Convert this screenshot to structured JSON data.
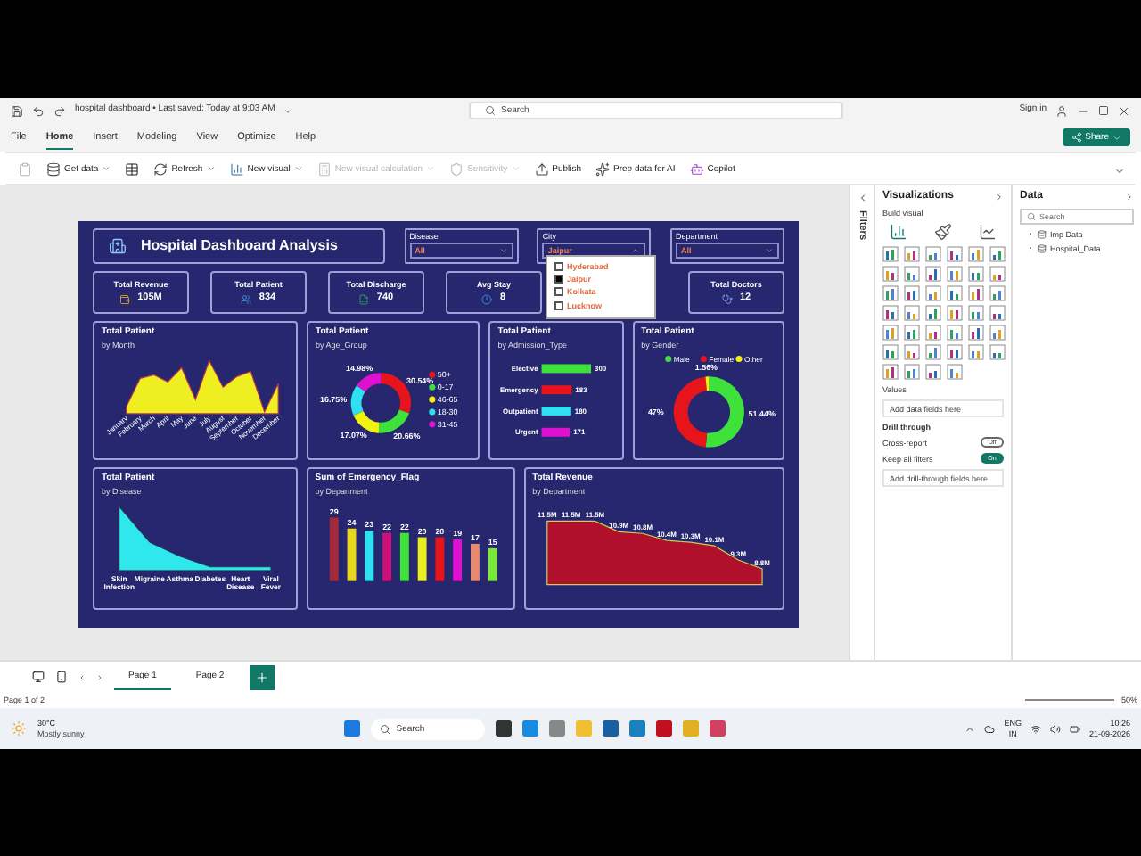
{
  "titlebar": {
    "file_title": "hospital dashboard • Last saved: Today at 9:03 AM",
    "search": "Search",
    "sign_in": "Sign in"
  },
  "menu": [
    {
      "label": "File",
      "selected": false
    },
    {
      "label": "Home",
      "selected": true
    },
    {
      "label": "Insert",
      "selected": false
    },
    {
      "label": "Modeling",
      "selected": false
    },
    {
      "label": "View",
      "selected": false
    },
    {
      "label": "Optimize",
      "selected": false
    },
    {
      "label": "Help",
      "selected": false
    }
  ],
  "share": "Share",
  "ribbon": [
    {
      "label": "Get data",
      "disabled": false
    },
    {
      "label": "Refresh",
      "disabled": false
    },
    {
      "label": "New visual",
      "disabled": false
    },
    {
      "label": "New visual calculation",
      "disabled": true
    },
    {
      "label": "Sensitivity",
      "disabled": true
    },
    {
      "label": "Publish",
      "disabled": false
    },
    {
      "label": "Prep data for AI",
      "disabled": false
    },
    {
      "label": "Copilot",
      "disabled": false
    }
  ],
  "dashboard": {
    "title": "Hospital Dashboard Analysis",
    "slicers": [
      {
        "label": "Disease",
        "value": "All",
        "open": false
      },
      {
        "label": "City",
        "value": "Jaipur",
        "open": true
      },
      {
        "label": "Department",
        "value": "All",
        "open": false
      }
    ],
    "city_options": [
      {
        "label": "Hyderabad",
        "checked": false
      },
      {
        "label": "Jaipur",
        "checked": true
      },
      {
        "label": "Kolkata",
        "checked": false
      },
      {
        "label": "Lucknow",
        "checked": false
      }
    ],
    "kpis": [
      {
        "label": "Total Revenue",
        "value": "105M"
      },
      {
        "label": "Total Patient",
        "value": "834"
      },
      {
        "label": "Total Discharge",
        "value": "740"
      },
      {
        "label": "Avg Stay",
        "value": "8"
      },
      {
        "label": "Total Doctors",
        "value": "12"
      }
    ],
    "charts_top": [
      {
        "kind": "month_area",
        "title": "Total Patient",
        "subtitle": "by Month",
        "x_labels": [
          "January",
          "February",
          "March",
          "April",
          "May",
          "June",
          "July",
          "August",
          "September",
          "October",
          "November",
          "December"
        ]
      },
      {
        "kind": "donut",
        "title": "Total Patient",
        "subtitle": "by Age_Group",
        "chart_data": {
          "type": "donut",
          "legend": "right",
          "categories": [
            "50+",
            "0-17",
            "46-65",
            "18-30",
            "31-45"
          ],
          "values": [
            30.54,
            20.66,
            17.07,
            16.75,
            14.98
          ],
          "colors": [
            "#e8141c",
            "#3ee23a",
            "#f2f20f",
            "#2ee0f0",
            "#e010d0"
          ],
          "value_labels": [
            "30.54%",
            "20.66%",
            "17.07%",
            "16.75%",
            "14.98%"
          ]
        }
      },
      {
        "kind": "hbar",
        "title": "Total Patient",
        "subtitle": "by Admission_Type",
        "chart_data": {
          "type": "bar",
          "orientation": "horizontal",
          "categories": [
            "Elective",
            "Emergency",
            "Outpatient",
            "Urgent"
          ],
          "values": [
            300,
            183,
            180,
            171
          ],
          "colors": [
            "#3ee23a",
            "#e8141c",
            "#2ee0f0",
            "#e010d0"
          ],
          "data_labels": true
        }
      },
      {
        "kind": "donut_legend",
        "title": "Total Patient",
        "subtitle": "by Gender",
        "chart_data": {
          "type": "donut",
          "legend": "top",
          "categories": [
            "Male",
            "Female",
            "Other"
          ],
          "values": [
            51.44,
            47,
            1.56
          ],
          "colors": [
            "#3ee23a",
            "#e8141c",
            "#f2f20f"
          ],
          "value_labels": [
            "51.44%",
            "47%",
            "1.56%"
          ]
        }
      }
    ],
    "charts_bottom": [
      {
        "kind": "disease_area",
        "title": "Total Patient",
        "subtitle": "by Disease",
        "x_labels": [
          "Skin Infection",
          "Migraine",
          "Asthma",
          "Diabetes",
          "Heart Disease",
          "Viral Fever"
        ]
      },
      {
        "kind": "vbar",
        "title": "Sum of Emergency_Flag",
        "subtitle": "by Department",
        "chart_data": {
          "type": "bar",
          "values": [
            29,
            24,
            23,
            22,
            22,
            20,
            20,
            19,
            17,
            15
          ],
          "colors": [
            "#a32a3a",
            "#e8d81a",
            "#2ee0f0",
            "#d0107a",
            "#3ee23a",
            "#e8f020",
            "#e8141c",
            "#e010d0",
            "#e88a70",
            "#7ae83a"
          ],
          "data_labels": true
        }
      },
      {
        "kind": "rev_area",
        "title": "Total Revenue",
        "subtitle": "by Department",
        "point_labels": [
          "11.5M",
          "11.5M",
          "11.5M",
          "10.9M",
          "10.8M",
          "10.4M",
          "10.3M",
          "10.1M",
          "9.3M",
          "8.8M"
        ]
      }
    ]
  },
  "visualizations": {
    "title": "Visualizations",
    "build": "Build visual",
    "values_label": "Values",
    "values_placeholder": "Add data fields here",
    "drill": "Drill through",
    "toggles": [
      {
        "label": "Cross-report",
        "on": false,
        "state_text": "Off"
      },
      {
        "label": "Keep all filters",
        "on": true,
        "state_text": "On"
      }
    ],
    "drill_placeholder": "Add drill-through fields here"
  },
  "filters": "Filters",
  "data_pane": {
    "title": "Data",
    "search_placeholder": "Search",
    "items": [
      {
        "label": "Imp Data",
        "expanded": false
      },
      {
        "label": "Hospital_Data",
        "expanded": false
      }
    ]
  },
  "pages": [
    {
      "label": "Page 1",
      "selected": true
    },
    {
      "label": "Page 2",
      "selected": false
    }
  ],
  "status": {
    "page": "Page 1 of 2",
    "zoom": "50%"
  },
  "taskbar": {
    "temp": "30°C",
    "weather": "Mostly sunny",
    "search": "Search",
    "lang": "ENG",
    "region": "IN",
    "time": "10:26",
    "date": "21-09-2026"
  }
}
